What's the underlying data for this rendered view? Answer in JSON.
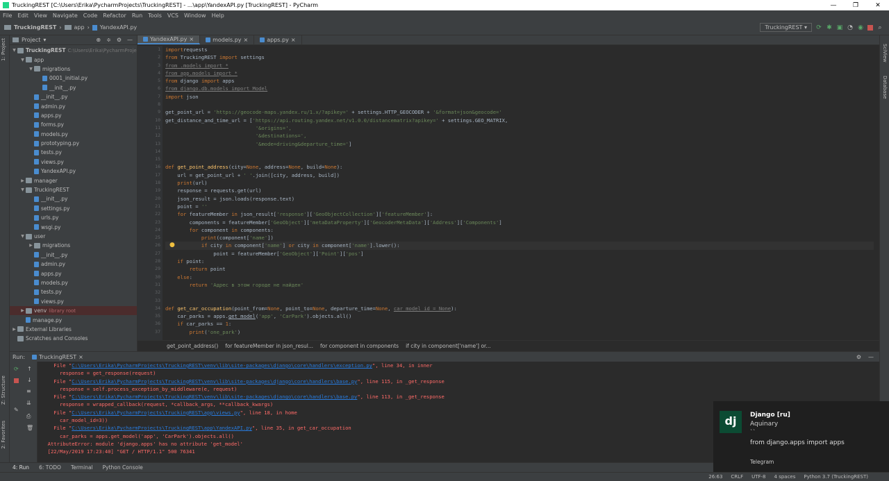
{
  "window": {
    "title": "TruckingREST [C:\\Users\\Erika\\PycharmProjects\\TruckingREST] - ...\\app\\YandexAPI.py [TruckingREST] - PyCharm",
    "minimize": "—",
    "maximize": "❐",
    "close": "✕"
  },
  "menu": [
    "File",
    "Edit",
    "View",
    "Navigate",
    "Code",
    "Refactor",
    "Run",
    "Tools",
    "VCS",
    "Window",
    "Help"
  ],
  "nav": {
    "crumbs": [
      "TruckingREST",
      "app",
      "YandexAPI.py"
    ],
    "run_config": "TruckingREST"
  },
  "left_strip": {
    "project": "1: Project",
    "structure": "Z: Structure",
    "favorites": "2: Favorites"
  },
  "right_strip": {
    "sciview": "SciView",
    "database": "Database"
  },
  "project": {
    "title": "Project",
    "items": [
      {
        "label": "TruckingREST",
        "extra": "C:\\Users\\Erika\\PycharmProje",
        "indent": 0,
        "arrow": "▼",
        "type": "folder",
        "bold": true
      },
      {
        "label": "app",
        "indent": 1,
        "arrow": "▼",
        "type": "folder"
      },
      {
        "label": "migrations",
        "indent": 2,
        "arrow": "▼",
        "type": "folder"
      },
      {
        "label": "0001_initial.py",
        "indent": 3,
        "arrow": "",
        "type": "py"
      },
      {
        "label": "__init__.py",
        "indent": 3,
        "arrow": "",
        "type": "py"
      },
      {
        "label": "__init__.py",
        "indent": 2,
        "arrow": "",
        "type": "py"
      },
      {
        "label": "admin.py",
        "indent": 2,
        "arrow": "",
        "type": "py"
      },
      {
        "label": "apps.py",
        "indent": 2,
        "arrow": "",
        "type": "py"
      },
      {
        "label": "forms.py",
        "indent": 2,
        "arrow": "",
        "type": "py"
      },
      {
        "label": "models.py",
        "indent": 2,
        "arrow": "",
        "type": "py"
      },
      {
        "label": "prototyping.py",
        "indent": 2,
        "arrow": "",
        "type": "py"
      },
      {
        "label": "tests.py",
        "indent": 2,
        "arrow": "",
        "type": "py"
      },
      {
        "label": "views.py",
        "indent": 2,
        "arrow": "",
        "type": "py"
      },
      {
        "label": "YandexAPI.py",
        "indent": 2,
        "arrow": "",
        "type": "py"
      },
      {
        "label": "manager",
        "indent": 1,
        "arrow": "▶",
        "type": "folder"
      },
      {
        "label": "TruckingREST",
        "indent": 1,
        "arrow": "▼",
        "type": "folder"
      },
      {
        "label": "__init__.py",
        "indent": 2,
        "arrow": "",
        "type": "py"
      },
      {
        "label": "settings.py",
        "indent": 2,
        "arrow": "",
        "type": "py"
      },
      {
        "label": "urls.py",
        "indent": 2,
        "arrow": "",
        "type": "py"
      },
      {
        "label": "wsgi.py",
        "indent": 2,
        "arrow": "",
        "type": "py"
      },
      {
        "label": "user",
        "indent": 1,
        "arrow": "▼",
        "type": "folder"
      },
      {
        "label": "migrations",
        "indent": 2,
        "arrow": "▶",
        "type": "folder"
      },
      {
        "label": "__init__.py",
        "indent": 2,
        "arrow": "",
        "type": "py"
      },
      {
        "label": "admin.py",
        "indent": 2,
        "arrow": "",
        "type": "py"
      },
      {
        "label": "apps.py",
        "indent": 2,
        "arrow": "",
        "type": "py"
      },
      {
        "label": "models.py",
        "indent": 2,
        "arrow": "",
        "type": "py"
      },
      {
        "label": "tests.py",
        "indent": 2,
        "arrow": "",
        "type": "py"
      },
      {
        "label": "views.py",
        "indent": 2,
        "arrow": "",
        "type": "py"
      },
      {
        "label": "venv",
        "extra": "library root",
        "indent": 1,
        "arrow": "▶",
        "type": "folder",
        "highlight": true
      },
      {
        "label": "manage.py",
        "indent": 1,
        "arrow": "",
        "type": "py"
      },
      {
        "label": "External Libraries",
        "indent": 0,
        "arrow": "▶",
        "type": "lib"
      },
      {
        "label": "Scratches and Consoles",
        "indent": 0,
        "arrow": "",
        "type": "lib"
      }
    ]
  },
  "tabs": [
    {
      "label": "YandexAPI.py",
      "active": true
    },
    {
      "label": "models.py",
      "active": false
    },
    {
      "label": "apps.py",
      "active": false
    }
  ],
  "breadcrumbs": [
    "get_point_address()",
    "for featureMember in json_resul...",
    "for component in components",
    "if city in component['name'] or..."
  ],
  "run": {
    "label": "Run:",
    "config": "TruckingREST"
  },
  "bottom_tabs": [
    "4: Run",
    "6: TODO",
    "Terminal",
    "Python Console"
  ],
  "status": [
    "26:63",
    "CRLF",
    "UTF-8",
    "4 spaces",
    "Python 3.7 (TruckingREST)"
  ],
  "notification": {
    "logo": "dj",
    "title": "Django [ru]",
    "sender": "Aquinary",
    "quote": "``",
    "message": "from django.apps import apps",
    "source": "Telegram"
  },
  "console_lines": [
    {
      "cls": "err",
      "pre": "    File \"",
      "link": "C:\\Users\\Erika\\PycharmProjects\\TruckingREST\\venv\\lib\\site-packages\\django\\core\\handlers\\exception.py",
      "post": "\", line 34, in inner"
    },
    {
      "cls": "err",
      "pre": "      response = get_response(request)",
      "link": "",
      "post": ""
    },
    {
      "cls": "err",
      "pre": "    File \"",
      "link": "C:\\Users\\Erika\\PycharmProjects\\TruckingREST\\venv\\lib\\site-packages\\django\\core\\handlers\\base.py",
      "post": "\", line 115, in _get_response"
    },
    {
      "cls": "err",
      "pre": "      response = self.process_exception_by_middleware(e, request)",
      "link": "",
      "post": ""
    },
    {
      "cls": "err",
      "pre": "    File \"",
      "link": "C:\\Users\\Erika\\PycharmProjects\\TruckingREST\\venv\\lib\\site-packages\\django\\core\\handlers\\base.py",
      "post": "\", line 113, in _get_response"
    },
    {
      "cls": "err",
      "pre": "      response = wrapped_callback(request, *callback_args, **callback_kwargs)",
      "link": "",
      "post": ""
    },
    {
      "cls": "err",
      "pre": "    File \"",
      "link": "C:\\Users\\Erika\\PycharmProjects\\TruckingREST\\app\\views.py",
      "post": "\", line 18, in home"
    },
    {
      "cls": "err",
      "pre": "      car_model_id=3))",
      "link": "",
      "post": ""
    },
    {
      "cls": "err",
      "pre": "    File \"",
      "link": "C:\\Users\\Erika\\PycharmProjects\\TruckingREST\\app\\YandexAPI.py",
      "post": "\", line 35, in get_car_occupation"
    },
    {
      "cls": "err",
      "pre": "      car_parks = apps.get_model('app', 'CarPark').objects.all()",
      "link": "",
      "post": ""
    },
    {
      "cls": "err",
      "pre": "  AttributeError: module 'django.apps' has no attribute 'get_model'",
      "link": "",
      "post": ""
    },
    {
      "cls": "err",
      "pre": "  [22/May/2019 17:23:40] \"GET / HTTP/1.1\" 500 76341",
      "link": "",
      "post": ""
    }
  ],
  "code_lines": [
    [
      [
        "kw",
        "import"
      ],
      [
        "",
        "requests"
      ]
    ],
    [
      [
        "kw",
        "from"
      ],
      [
        "",
        " TruckingREST "
      ],
      [
        "kw",
        "import"
      ],
      [
        "",
        " settings"
      ]
    ],
    [
      [
        "un",
        "from .models import *"
      ]
    ],
    [
      [
        "un",
        "from app.models import *"
      ]
    ],
    [
      [
        "kw",
        "from"
      ],
      [
        "",
        " django "
      ],
      [
        "kw",
        "import"
      ],
      [
        "",
        " apps"
      ]
    ],
    [
      [
        "un",
        "from django.db.models import Model"
      ]
    ],
    [
      [
        "kw",
        "import"
      ],
      [
        "",
        " json"
      ]
    ],
    [],
    [
      [
        "",
        "get_point_url = "
      ],
      [
        "st",
        "'https://geocode-maps.yandex.ru/1.x/?apikey='"
      ],
      [
        "",
        " + settings.HTTP_GEOCODER + "
      ],
      [
        "st",
        "'&format=json&geocode='"
      ]
    ],
    [
      [
        "",
        "get_distance_and_time_url = ["
      ],
      [
        "st",
        "'https://api.routing.yandex.net/v1.0.0/distancematrix?apikey='"
      ],
      [
        "",
        " + settings.GEO_MATRIX,"
      ]
    ],
    [
      [
        "",
        "                              "
      ],
      [
        "st",
        "'&origins=',"
      ]
    ],
    [
      [
        "",
        "                              "
      ],
      [
        "st",
        "'&destinations=',"
      ]
    ],
    [
      [
        "",
        "                              "
      ],
      [
        "st",
        "'&mode=driving&departure_time='"
      ],
      [
        "",
        "]"
      ]
    ],
    [],
    [],
    [
      [
        "kw",
        "def "
      ],
      [
        "fn",
        "get_point_address"
      ],
      [
        "",
        "(city="
      ],
      [
        "kw",
        "None"
      ],
      [
        "",
        ", address="
      ],
      [
        "kw",
        "None"
      ],
      [
        "",
        ", build="
      ],
      [
        "kw",
        "None"
      ],
      [
        "",
        "):"
      ]
    ],
    [
      [
        "",
        "    url = get_point_url + "
      ],
      [
        "st",
        "' '"
      ],
      [
        "",
        ".join([city, address, build])"
      ]
    ],
    [
      [
        "kw",
        "    print"
      ],
      [
        "",
        "(url)"
      ]
    ],
    [
      [
        "",
        "    response = requests.get(url)"
      ]
    ],
    [
      [
        "",
        "    json_result = json.loads(response.text)"
      ]
    ],
    [
      [
        "",
        "    point = "
      ],
      [
        "st",
        "''"
      ]
    ],
    [
      [
        "kw",
        "    for"
      ],
      [
        "",
        " featureMember "
      ],
      [
        "kw",
        "in"
      ],
      [
        "",
        " json_result["
      ],
      [
        "st",
        "'response'"
      ],
      [
        "",
        "]["
      ],
      [
        "st",
        "'GeoObjectCollection'"
      ],
      [
        "",
        "]["
      ],
      [
        "st",
        "'featureMember'"
      ],
      [
        "",
        "]:"
      ]
    ],
    [
      [
        "",
        "        components = featureMember["
      ],
      [
        "st",
        "'GeoObject'"
      ],
      [
        "",
        "]["
      ],
      [
        "st",
        "'metaDataProperty'"
      ],
      [
        "",
        "]["
      ],
      [
        "st",
        "'GeocoderMetaData'"
      ],
      [
        "",
        "]["
      ],
      [
        "st",
        "'Address'"
      ],
      [
        "",
        "]["
      ],
      [
        "st",
        "'Components'"
      ],
      [
        "",
        "]"
      ]
    ],
    [
      [
        "kw",
        "        for"
      ],
      [
        "",
        " component "
      ],
      [
        "kw",
        "in"
      ],
      [
        "",
        " components:"
      ]
    ],
    [
      [
        "kw",
        "            print"
      ],
      [
        "",
        "(component["
      ],
      [
        "st",
        "'name'"
      ],
      [
        "",
        "])"
      ]
    ],
    [
      [
        "kw",
        "            if"
      ],
      [
        "",
        " city "
      ],
      [
        "kw",
        "in"
      ],
      [
        "",
        " component["
      ],
      [
        "st",
        "'name'"
      ],
      [
        "",
        "] "
      ],
      [
        "kw",
        "or"
      ],
      [
        "",
        " city "
      ],
      [
        "kw",
        "in"
      ],
      [
        "",
        " component["
      ],
      [
        "st",
        "'name'"
      ],
      [
        "",
        "].lower():"
      ]
    ],
    [
      [
        "",
        "                point = featureMember["
      ],
      [
        "st",
        "'GeoObject'"
      ],
      [
        "",
        "]["
      ],
      [
        "st",
        "'Point'"
      ],
      [
        "",
        "]["
      ],
      [
        "st",
        "'pos'"
      ],
      [
        "",
        "]"
      ]
    ],
    [
      [
        "kw",
        "    if"
      ],
      [
        "",
        " point:"
      ]
    ],
    [
      [
        "kw",
        "        return"
      ],
      [
        "",
        " point"
      ]
    ],
    [
      [
        "kw",
        "    else"
      ],
      [
        "",
        ":"
      ]
    ],
    [
      [
        "kw",
        "        return "
      ],
      [
        "st",
        "'Адрес в этом городе не найден'"
      ]
    ],
    [],
    [],
    [
      [
        "kw",
        "def "
      ],
      [
        "fn",
        "get_car_occupation"
      ],
      [
        "",
        "(point_from="
      ],
      [
        "kw",
        "None"
      ],
      [
        "",
        ", point_to="
      ],
      [
        "kw",
        "None"
      ],
      [
        "",
        ", departure_time="
      ],
      [
        "kw",
        "None"
      ],
      [
        "",
        ", "
      ],
      [
        "un",
        "car_model_id = None"
      ],
      [
        "",
        "):"
      ]
    ],
    [
      [
        "",
        "    car_parks = apps."
      ],
      [
        "ul",
        "get_model"
      ],
      [
        "",
        "("
      ],
      [
        "st",
        "'app'"
      ],
      [
        "",
        ", "
      ],
      [
        "st",
        "'CarPark'"
      ],
      [
        "",
        ").objects.all()"
      ]
    ],
    [
      [
        "kw",
        "    if"
      ],
      [
        "",
        " car_parks == "
      ],
      [
        "kw",
        "1"
      ],
      [
        "",
        ":"
      ]
    ],
    [
      [
        "kw",
        "        print"
      ],
      [
        "",
        "("
      ],
      [
        "st",
        "'one_park'"
      ],
      [
        "",
        ")"
      ]
    ]
  ]
}
